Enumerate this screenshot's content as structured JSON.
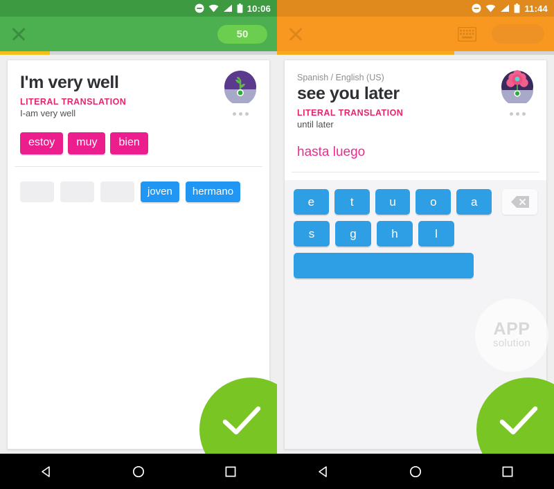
{
  "left": {
    "status_bar": {
      "time": "10:06",
      "icons": [
        "dnd-icon",
        "wifi-icon",
        "signal-icon",
        "battery-icon"
      ]
    },
    "app_bar": {
      "close_label": "close-icon",
      "score": "50"
    },
    "progress_percent": 18,
    "card": {
      "phrase": "I'm very well",
      "literal_label": "LITERAL TRANSLATION",
      "literal_text": "I-am very well",
      "avatar": "purple-sprout-avatar",
      "answer_tiles": [
        "estoy",
        "muy",
        "bien"
      ],
      "word_bank_blanks": 3,
      "word_bank": [
        "joven",
        "hermano"
      ]
    },
    "check_button_label": "check-icon",
    "nav": [
      "back-icon",
      "home-icon",
      "recents-icon"
    ],
    "colors": {
      "accent": "#4caf50",
      "progress": "#f2c017",
      "tile": "#ec1e8e",
      "word": "#2196f3",
      "fab": "#79c523"
    }
  },
  "right": {
    "status_bar": {
      "time": "11:44",
      "icons": [
        "dnd-icon",
        "wifi-icon",
        "signal-icon",
        "battery-icon"
      ]
    },
    "app_bar": {
      "close_label": "close-icon",
      "keyboard_label": "keyboard-icon",
      "pill_label": ""
    },
    "progress_percent": 64,
    "card": {
      "language_pair": "Spanish / English (US)",
      "phrase": "see you later",
      "literal_label": "LITERAL TRANSLATION",
      "literal_text": "until later",
      "avatar": "purple-flower-avatar",
      "typed_answer": "hasta luego"
    },
    "keyboard": {
      "row1": [
        "e",
        "t",
        "u",
        "o",
        "a"
      ],
      "row2": [
        "s",
        "g",
        "h",
        "l"
      ],
      "backspace_label": "backspace-icon",
      "space_label": ""
    },
    "check_button_label": "check-icon",
    "watermark": {
      "line1": "APP",
      "line2": "solution"
    },
    "nav": [
      "back-icon",
      "home-icon",
      "recents-icon"
    ],
    "colors": {
      "accent": "#f89821",
      "progress": "#f7a81b",
      "key": "#2e9fe5",
      "fab": "#79c523"
    }
  }
}
